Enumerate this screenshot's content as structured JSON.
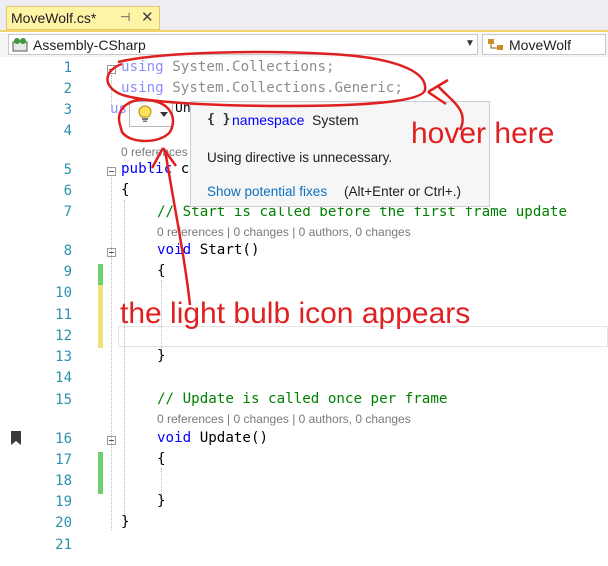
{
  "tab": {
    "title": "MoveWolf.cs*",
    "pin_glyph": "⊣",
    "close_glyph": "✕"
  },
  "navbar": {
    "project": "Assembly-CSharp",
    "class_name": "MoveWolf"
  },
  "code": {
    "line_numbers": [
      "1",
      "2",
      "3",
      "4",
      "5",
      "6",
      "7",
      "8",
      "9",
      "10",
      "11",
      "12",
      "13",
      "14",
      "15",
      "16",
      "17",
      "18",
      "19",
      "20",
      "21"
    ],
    "l1_kw": "using",
    "l1_rest": " System.Collections;",
    "l2_kw": "using",
    "l2_rest": " System.Collections.Generic;",
    "l3_kw": "us",
    "l3_rest": "Un",
    "l4_lens": "0 references",
    "l5_kw": "public",
    "l5_rest": " c",
    "l6": "{",
    "l7_comment": "// Start is called before the first frame update",
    "l7_lens": "0 references | 0 changes | 0 authors, 0 changes",
    "l8_kw": "void",
    "l8_rest": " Start()",
    "l9": "{",
    "l13": "}",
    "l15_comment": "// Update is called once per frame",
    "l15_lens": "0 references | 0 changes | 0 authors, 0 changes",
    "l16_kw": "void",
    "l16_rest": " Update()",
    "l17": "{",
    "l19": "}",
    "l20": "}"
  },
  "quick_info": {
    "brace_icon": "{ }",
    "keyword": "namespace",
    "name": "System",
    "message": "Using directive is unnecessary.",
    "link": "Show potential fixes",
    "shortcut": "(Alt+Enter or Ctrl+.)"
  },
  "annotations": {
    "hover_text": "hover here",
    "bulb_text": "the light bulb icon appears"
  },
  "colors": {
    "annotation": "#e02020",
    "keyword": "#0000ff",
    "comment": "#008000",
    "line_number": "#2b91af",
    "link": "#0e70c0"
  },
  "icons": [
    "csharp-project-icon",
    "class-icon",
    "light-bulb-icon",
    "dropdown-arrow-icon",
    "bookmark-icon"
  ]
}
